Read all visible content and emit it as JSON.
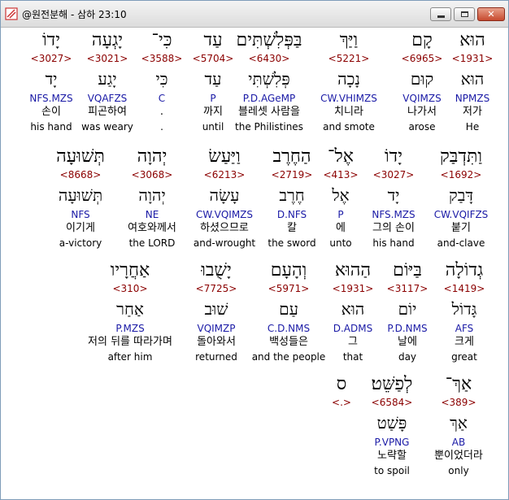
{
  "window": {
    "title": "@원전분해 - 삼하 23:10"
  },
  "titlebar": {
    "minimize_icon": "minimize-icon",
    "maximize_icon": "maximize-icon",
    "close_icon": "close-icon"
  },
  "rows": [
    {
      "words": [
        {
          "heb": "הוּא",
          "num": "<1931>",
          "lemma": "הוּא",
          "parse": "NPMZS",
          "ko": "저가",
          "en": "He"
        },
        {
          "heb": "קָם",
          "num": "<6965>",
          "lemma": "קוּם",
          "parse": "VQIMZS",
          "ko": "나가서",
          "en": "arose"
        },
        {
          "heb": "וַיַּךְ",
          "num": "<5221>",
          "lemma": "נָכָה",
          "parse": "CW.VHIMZS",
          "ko": "치니라",
          "en": "and smote"
        },
        {
          "heb": "בַּפְּלִשְׁתִּים",
          "num": "<6430>",
          "lemma": "פְּלִשְׁתִּי",
          "parse": "P.D.AGeMP",
          "ko": "블레셋 사람을",
          "en": "the Philistines"
        },
        {
          "heb": "עַד",
          "num": "<5704>",
          "lemma": "עַד",
          "parse": "P",
          "ko": "까지",
          "en": "until"
        },
        {
          "heb": "כִּי־",
          "num": "<3588>",
          "lemma": "כִּי",
          "parse": "C",
          "ko": ".",
          "en": "."
        },
        {
          "heb": "יָגְעָה",
          "num": "<3021>",
          "lemma": "יָגַע",
          "parse": "VQAFZS",
          "ko": "피곤하여",
          "en": "was weary"
        },
        {
          "heb": "יָדוֹ",
          "num": "<3027>",
          "lemma": "יָד",
          "parse": "NFS.MZS",
          "ko": "손이",
          "en": "his hand"
        }
      ]
    },
    {
      "words": [
        {
          "heb": "וַתִּדְבַּק",
          "num": "<1692>",
          "lemma": "דָּבַק",
          "parse": "CW.VQIFZS",
          "ko": "붙기",
          "en": "and-clave"
        },
        {
          "heb": "יָדוֹ",
          "num": "<3027>",
          "lemma": "יָד",
          "parse": "NFS.MZS",
          "ko": "그의 손이",
          "en": "his hand"
        },
        {
          "heb": "אֶל־",
          "num": "<413>",
          "lemma": "אֶל",
          "parse": "P",
          "ko": "에",
          "en": "unto"
        },
        {
          "heb": "הַחֶרֶב",
          "num": "<2719>",
          "lemma": "חֶרֶב",
          "parse": "D.NFS",
          "ko": "칼",
          "en": "the sword"
        },
        {
          "heb": "וַיַּעַשׂ",
          "num": "<6213>",
          "lemma": "עָשָׂה",
          "parse": "CW.VQIMZS",
          "ko": "하셨으므로",
          "en": "and-wrought"
        },
        {
          "heb": "יְהוָה",
          "num": "<3068>",
          "lemma": "יְהוָה",
          "parse": "NE",
          "ko": "여호와께서",
          "en": "the LORD"
        },
        {
          "heb": "תְּשׁוּעָה",
          "num": "<8668>",
          "lemma": "תְּשׁוּעָה",
          "parse": "NFS",
          "ko": "이기게",
          "en": "a-victory"
        }
      ]
    },
    {
      "words": [
        {
          "heb": "גְדוֹלָה",
          "num": "<1419>",
          "lemma": "גָּדוֹל",
          "parse": "AFS",
          "ko": "크게",
          "en": "great"
        },
        {
          "heb": "בַּיּוֹם",
          "num": "<3117>",
          "lemma": "יוֹם",
          "parse": "P.D.NMS",
          "ko": "날에",
          "en": "day"
        },
        {
          "heb": "הַהוּא",
          "num": "<1931>",
          "lemma": "הוּא",
          "parse": "D.ADMS",
          "ko": "그",
          "en": "that"
        },
        {
          "heb": "וְהָעָם",
          "num": "<5971>",
          "lemma": "עַם",
          "parse": "C.D.NMS",
          "ko": "백성들은",
          "en": "and the people"
        },
        {
          "heb": "יָשֻׁבוּ",
          "num": "<7725>",
          "lemma": "שׁוּב",
          "parse": "VQIMZP",
          "ko": "돌아와서",
          "en": "returned"
        },
        {
          "heb": "אַחֲרָיו",
          "num": "<310>",
          "lemma": "אַחַר",
          "parse": "P.MZS",
          "ko": "저의 뒤를 따라가며",
          "en": "after him"
        }
      ]
    },
    {
      "words": [
        {
          "heb": "אַךְ־",
          "num": "<389>",
          "lemma": "אַךְ",
          "parse": "AB",
          "ko": "뿐이었더라",
          "en": "only"
        },
        {
          "heb": "לְפַשֵּׁט׃",
          "num": "<6584>",
          "lemma": "פָּשַׁט",
          "parse": "P.VPNG",
          "ko": "노략할",
          "en": "to spoil"
        },
        {
          "heb": "ס",
          "num": "<.>",
          "lemma": "",
          "parse": "",
          "ko": "",
          "en": ""
        }
      ]
    }
  ]
}
